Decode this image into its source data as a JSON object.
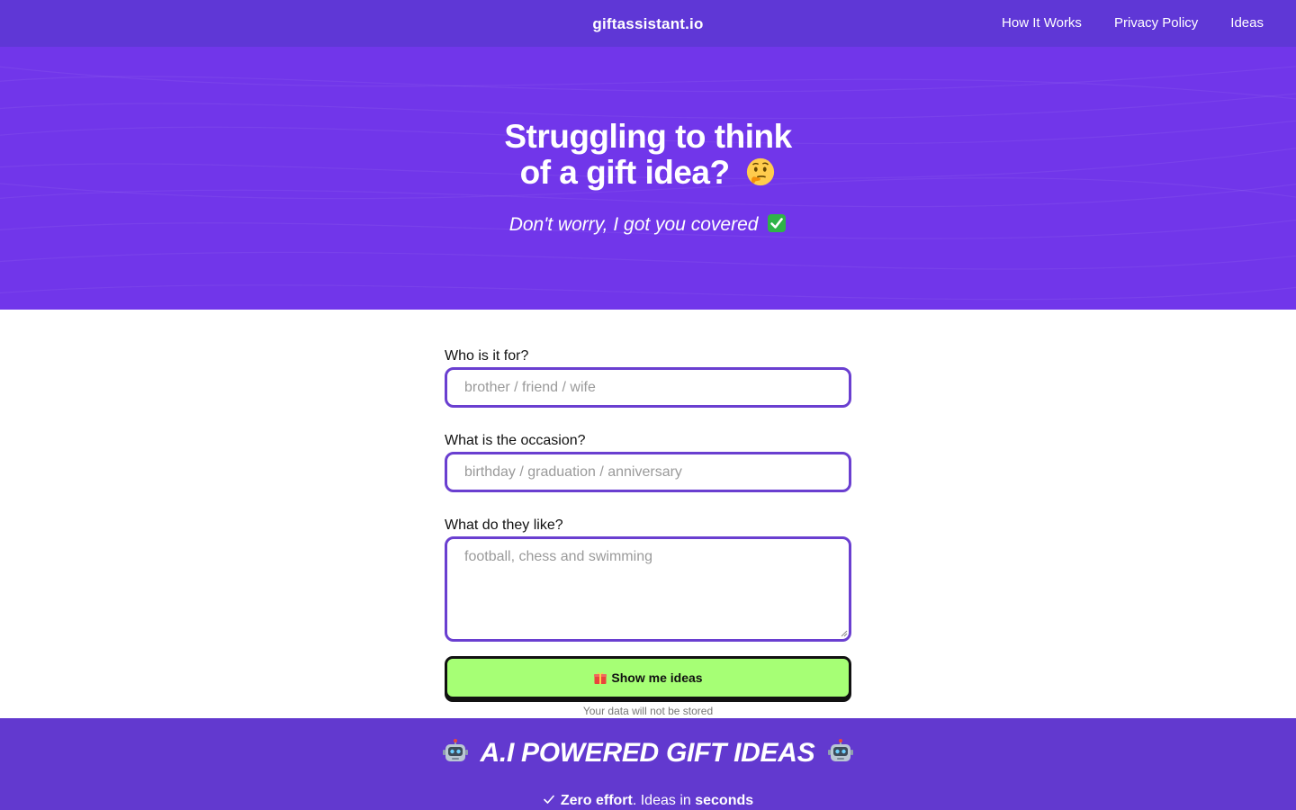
{
  "header": {
    "brand": "giftassistant.io",
    "nav": [
      "How It Works",
      "Privacy Policy",
      "Ideas"
    ]
  },
  "hero": {
    "title_line1": "Struggling to think",
    "title_line2": "of a gift idea?",
    "subtitle": "Don't worry, I got you covered",
    "title_emoji": "thinking-face-icon",
    "subtitle_emoji": "check-box-icon"
  },
  "form": {
    "who": {
      "label": "Who is it for?",
      "placeholder": "brother / friend / wife",
      "value": ""
    },
    "occasion": {
      "label": "What is the occasion?",
      "placeholder": "birthday / graduation / anniversary",
      "value": ""
    },
    "likes": {
      "label": "What do they like?",
      "placeholder": "football, chess and swimming",
      "value": ""
    },
    "submit_label": "Show me ideas",
    "note": "Your data will not be stored"
  },
  "features": {
    "title": "A.I POWERED GIFT IDEAS",
    "line_part1": "Zero effort",
    "line_part2": ". Ideas in ",
    "line_part3": "seconds"
  },
  "colors": {
    "topbar": "#5f37d6",
    "hero": "#7136ea",
    "field_border": "#6a3fd0",
    "button": "#a6ff75",
    "footer_band": "#6239cf"
  }
}
